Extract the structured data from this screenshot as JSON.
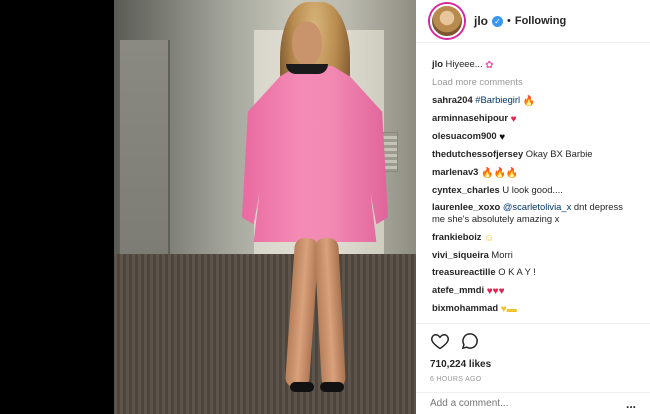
{
  "header": {
    "username": "jlo",
    "follow_state": "Following"
  },
  "caption": {
    "username": "jlo",
    "text": "Hiyeee..."
  },
  "load_more": "Load more comments",
  "comments": [
    {
      "username": "sahra204",
      "mention": "#Barbiegirl",
      "text": "",
      "emoji": [
        "flame"
      ]
    },
    {
      "username": "arminnasehipour",
      "mention": "",
      "text": "",
      "emoji": [
        "heart-red"
      ]
    },
    {
      "username": "olesuacom900",
      "mention": "",
      "text": "",
      "emoji": [
        "heart-black"
      ]
    },
    {
      "username": "thedutchessofjersey",
      "mention": "",
      "text": "Okay BX Barbie",
      "emoji": []
    },
    {
      "username": "marlenav3",
      "mention": "",
      "text": "",
      "emoji": [
        "flame",
        "flame",
        "flame"
      ]
    },
    {
      "username": "cyntex_charles",
      "mention": "",
      "text": "U look good....",
      "emoji": []
    },
    {
      "username": "laurenlee_xoxo",
      "mention": "@scarletolivia_x",
      "text": "dnt depress me she's absolutely amazing x",
      "emoji": []
    },
    {
      "username": "frankieboiz",
      "mention": "",
      "text": "",
      "emoji": [
        "grin"
      ]
    },
    {
      "username": "vivi_siqueira",
      "mention": "",
      "text": "Morri",
      "emoji": []
    },
    {
      "username": "treasureactille",
      "mention": "",
      "text": "O K A Y !",
      "emoji": []
    },
    {
      "username": "atefe_mmdi",
      "mention": "",
      "text": "",
      "emoji": [
        "heart-red",
        "heart-red",
        "heart-red"
      ]
    },
    {
      "username": "bixmohammad",
      "mention": "",
      "text": "",
      "emoji": [
        "heart-yellow",
        "emoji-box"
      ]
    }
  ],
  "likes": "710,224 likes",
  "time": "6 HOURS AGO",
  "add_comment": {
    "placeholder": "Add a comment...",
    "more": "..."
  },
  "colors": {
    "link": "#003569",
    "verified": "#3897f0",
    "muted": "#999999"
  }
}
